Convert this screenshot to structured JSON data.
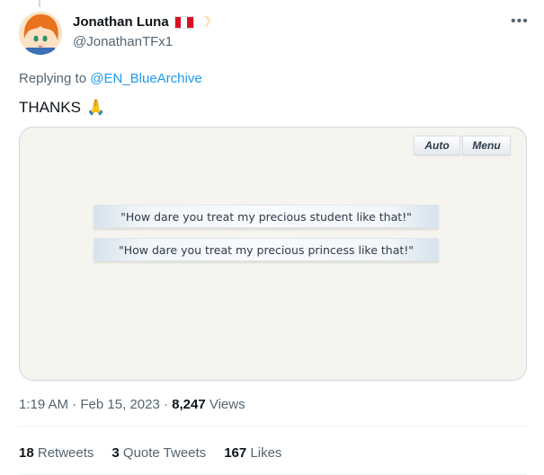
{
  "author": {
    "display_name": "Jonathan Luna",
    "handle": "@JonathanTFx1",
    "flag_colors": [
      "#d91023",
      "#ffffff",
      "#d91023"
    ],
    "moon_icon": "crescent-moon-icon"
  },
  "reply": {
    "prefix": "Replying to",
    "mention": "@EN_BlueArchive"
  },
  "tweet": {
    "text": "THANKS",
    "emoji": "🙏"
  },
  "media": {
    "buttons": {
      "auto": "Auto",
      "menu": "Menu"
    },
    "choices": [
      "\"How dare you treat my precious student like that!\"",
      "\"How dare you treat my precious princess like that!\""
    ]
  },
  "meta": {
    "time": "1:19 AM",
    "date": "Feb 15, 2023",
    "views_count": "8,247",
    "views_label": "Views"
  },
  "stats": {
    "retweets_count": "18",
    "retweets_label": "Retweets",
    "quotes_count": "3",
    "quotes_label": "Quote Tweets",
    "likes_count": "167",
    "likes_label": "Likes"
  },
  "colors": {
    "link": "#1d9bf0",
    "muted": "#536471",
    "text": "#0f1419"
  }
}
